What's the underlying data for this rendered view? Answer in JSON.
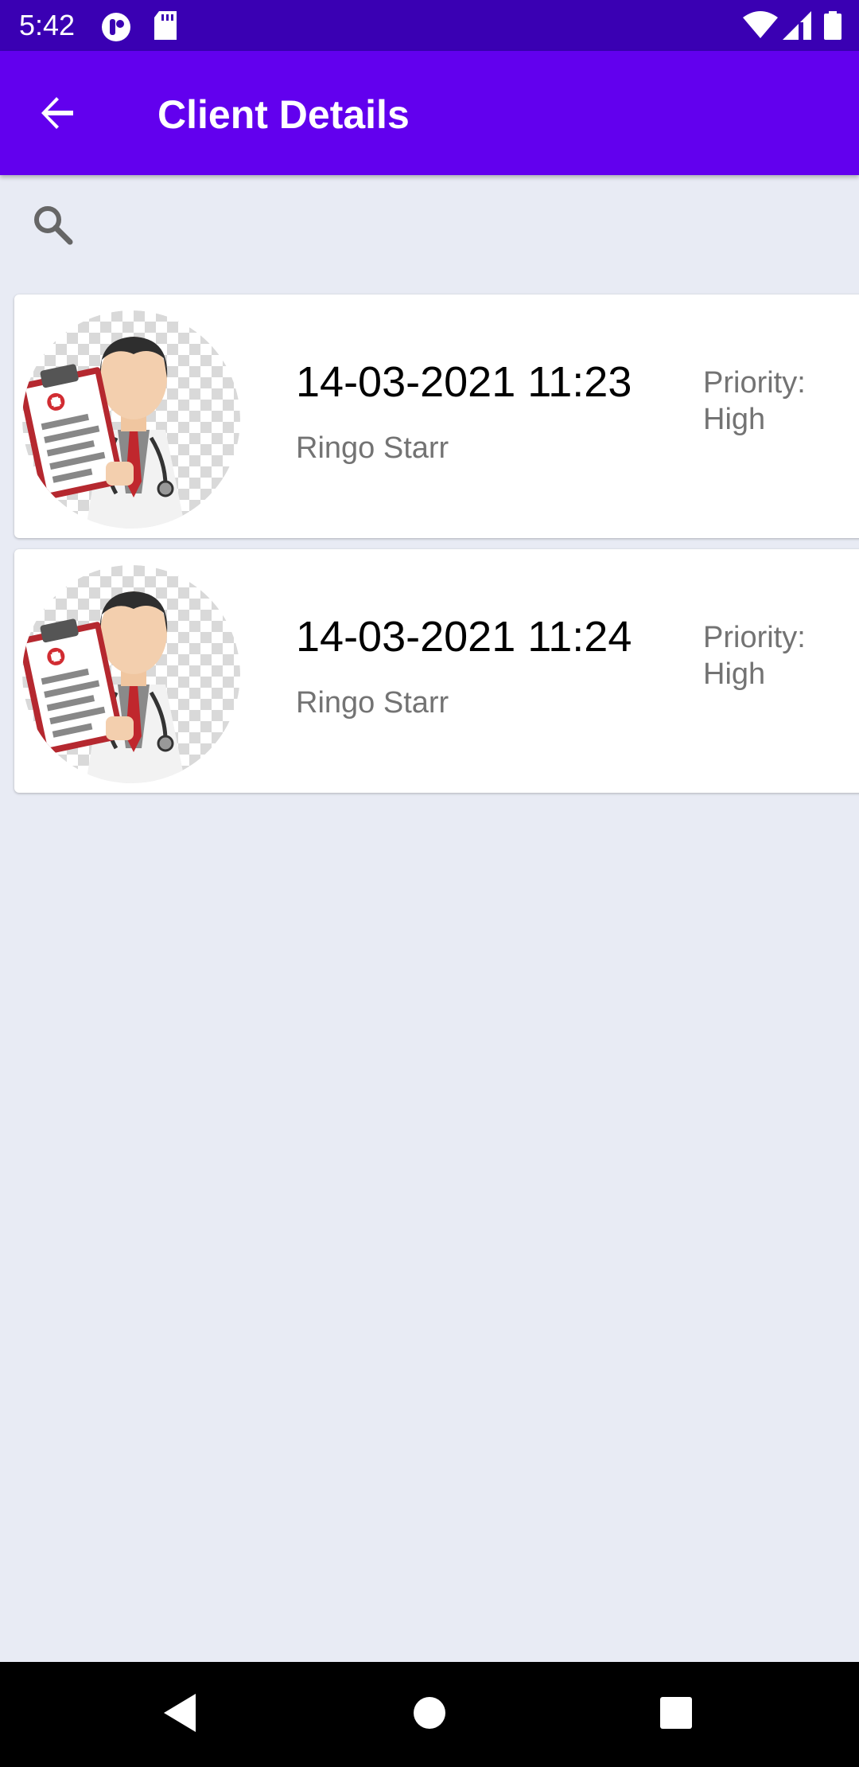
{
  "status_bar": {
    "time": "5:42",
    "icons": [
      "app-notification-icon",
      "sd-card-icon",
      "wifi-icon",
      "cell-signal-icon",
      "battery-icon"
    ]
  },
  "app_bar": {
    "title": "Client Details",
    "back_icon": "arrow-back-icon",
    "background": "#6200ee"
  },
  "search": {
    "icon": "search-icon"
  },
  "clients": [
    {
      "datetime": "14-03-2021 11:23",
      "name": "Ringo Starr",
      "priority_label": "Priority:",
      "priority_value": "High",
      "avatar_icon": "doctor-avatar-icon"
    },
    {
      "datetime": "14-03-2021 11:24",
      "name": "Ringo Starr",
      "priority_label": "Priority:",
      "priority_value": "High",
      "avatar_icon": "doctor-avatar-icon"
    }
  ],
  "nav_bar": {
    "icons": [
      "back-triangle-icon",
      "home-circle-icon",
      "recents-square-icon"
    ]
  },
  "colors": {
    "status_bar": "#3a00b3",
    "app_bar": "#6200ee",
    "background": "#e8ebf4",
    "card": "#ffffff",
    "secondary_text": "#737373"
  }
}
